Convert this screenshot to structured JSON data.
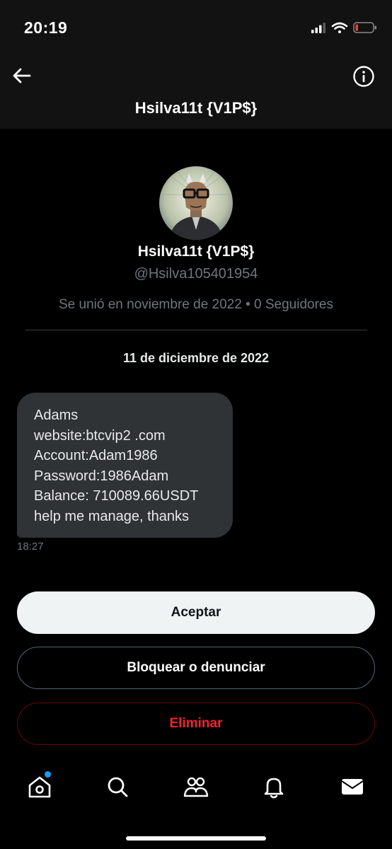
{
  "status_bar": {
    "time": "20:19"
  },
  "header": {
    "title": "Hsilva11t {V1P$}"
  },
  "profile": {
    "name": "Hsilva11t {V1P$}",
    "handle": "@Hsilva105401954",
    "meta": "Se unió en noviembre de 2022 • 0 Seguidores"
  },
  "conversation": {
    "date": "11 de diciembre de 2022",
    "message": {
      "lines": [
        "Adams",
        "website:btcvip2 .com",
        "Account:Adam1986",
        "Password:1986Adam",
        "Balance: 710089.66USDT",
        "help me manage, thanks"
      ],
      "time": "18:27"
    }
  },
  "actions": {
    "accept": "Aceptar",
    "block_report": "Bloquear o denunciar",
    "delete": "Eliminar"
  },
  "tab_bar": {
    "items": [
      "home-icon",
      "search-icon",
      "communities-icon",
      "notifications-icon",
      "messages-icon"
    ],
    "active_badge": "home"
  },
  "colors": {
    "accent": "#1d9bf0",
    "danger": "#f4212e",
    "bubble": "#2f3336",
    "muted": "#71767b"
  }
}
